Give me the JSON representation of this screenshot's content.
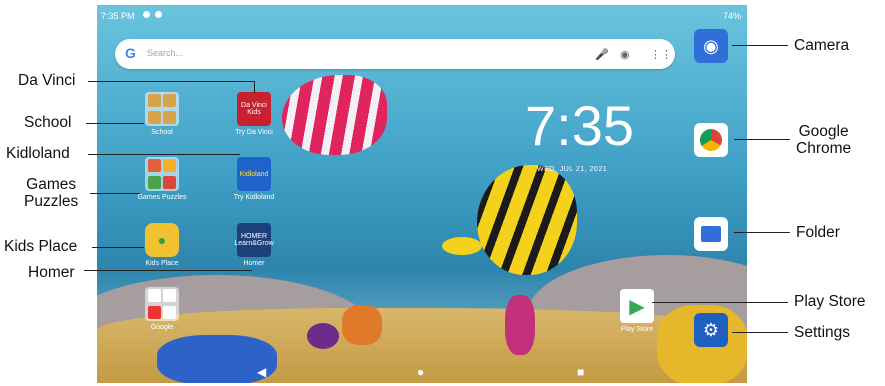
{
  "status_bar": {
    "time": "7:35 PM",
    "battery": "74%"
  },
  "search": {
    "placeholder": "Search..."
  },
  "clock": {
    "time": "7:35",
    "date": "WED, JUL 21, 2021"
  },
  "home_apps": [
    {
      "label": "School"
    },
    {
      "label": "Try Da Vinci",
      "tile_text": "Da Vinci Kids"
    },
    {
      "label": "Games Puzzles"
    },
    {
      "label": "Try Kidloland",
      "tile_text": "Kidloland"
    },
    {
      "label": "Kids Place"
    },
    {
      "label": "Homer",
      "tile_text": "HOMER Learn&Grow"
    },
    {
      "label": "Google"
    }
  ],
  "dock_apps": [
    {
      "label": "Play Store"
    }
  ],
  "callouts": {
    "left": [
      "Da Vinci",
      "School",
      "Kidloland",
      "Games\nPuzzles",
      "Kids Place",
      "Homer"
    ],
    "right": [
      "Camera",
      "Google\nChrome",
      "Folder",
      "Play Store",
      "Settings"
    ]
  },
  "icons": [
    "camera-icon",
    "chrome-icon",
    "folder-icon",
    "play-store-icon",
    "settings-icon",
    "mic-icon",
    "lens-icon",
    "apps-grid-icon"
  ],
  "colors": {
    "sky": "#4aa6cd",
    "sand": "#c9a24c",
    "dock_blue": "#1f5fbf"
  }
}
